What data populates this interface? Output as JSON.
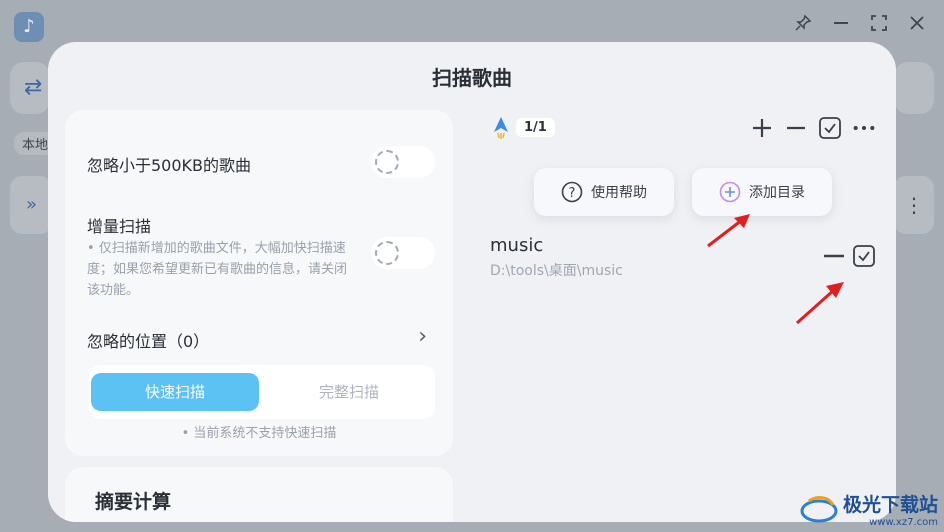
{
  "background": {
    "logo_glyph": "♪",
    "label_partial": "本地",
    "controls": [
      "pin-icon",
      "minimize-icon",
      "fullscreen-icon",
      "close-icon"
    ]
  },
  "modal": {
    "title": "扫描歌曲",
    "settings": {
      "ignore_small": "忽略小于500KB的歌曲",
      "incremental_title": "增量扫描",
      "incremental_desc": "• 仅扫描新增加的歌曲文件，大幅加快扫描速度；如果您希望更新已有歌曲的信息，请关闭该功能。",
      "ignored_locations": "忽略的位置（0）",
      "quick_scan": "快速扫描",
      "full_scan": "完整扫描",
      "note": "• 当前系统不支持快速扫描"
    },
    "digest_title": "摘要计算",
    "folders": {
      "count": "1/1",
      "help_label": "使用帮助",
      "add_label": "添加目录",
      "items": [
        {
          "name": "music",
          "path": "D:\\tools\\桌面\\music"
        }
      ]
    }
  },
  "watermark": {
    "text": "极光下载站",
    "url": "www.xz7.com"
  },
  "colors": {
    "accent": "#5bc2f3",
    "arrow": "#e02020",
    "modal_bg": "#eff1f4"
  }
}
